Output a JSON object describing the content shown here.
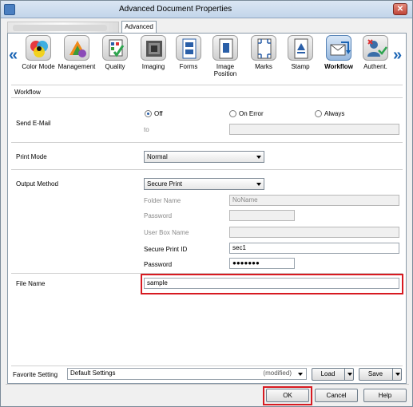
{
  "window": {
    "title": "Advanced Document Properties",
    "close_glyph": "✕"
  },
  "tabs": [
    {
      "label": ""
    },
    {
      "label": "Advanced"
    }
  ],
  "function_tabs": [
    {
      "label": "Color Mode",
      "icon": "color-mode-icon"
    },
    {
      "label": "Management",
      "icon": "management-icon"
    },
    {
      "label": "Quality",
      "icon": "quality-icon"
    },
    {
      "label": "Imaging",
      "icon": "imaging-icon"
    },
    {
      "label": "Forms",
      "icon": "forms-icon"
    },
    {
      "label": "Image Position",
      "icon": "image-position-icon"
    },
    {
      "label": "Marks",
      "icon": "marks-icon"
    },
    {
      "label": "Stamp",
      "icon": "stamp-icon"
    },
    {
      "label": "Workflow",
      "icon": "workflow-icon",
      "selected": true
    },
    {
      "label": "Authent.",
      "icon": "authentication-icon"
    }
  ],
  "nav": {
    "prev": "«",
    "next": "»"
  },
  "workflow": {
    "section_title": "Workflow",
    "send_email": {
      "label": "Send E-Mail",
      "options": [
        "Off",
        "On Error",
        "Always"
      ],
      "selected": "Off",
      "to_label": "to",
      "to_value": ""
    },
    "print_mode": {
      "label": "Print Mode",
      "value": "Normal"
    },
    "output_method": {
      "label": "Output Method",
      "value": "Secure Print",
      "folder_name_label": "Folder Name",
      "folder_name_value": "NoName",
      "password_label": "Password",
      "password_value": "",
      "user_box_name_label": "User Box Name",
      "user_box_name_value": "",
      "secure_print_id_label": "Secure Print ID",
      "secure_print_id_value": "sec1",
      "secure_password_label": "Password",
      "secure_password_value": "●●●●●●●"
    },
    "file_name": {
      "label": "File Name",
      "value": "sample"
    }
  },
  "favorite": {
    "label": "Favorite Setting",
    "value": "Default Settings",
    "status": "(modified)",
    "load": "Load",
    "save": "Save"
  },
  "buttons": {
    "ok": "OK",
    "cancel": "Cancel",
    "help": "Help"
  },
  "colors": {
    "highlight": "#d71a21",
    "accent": "#1a64b4"
  }
}
